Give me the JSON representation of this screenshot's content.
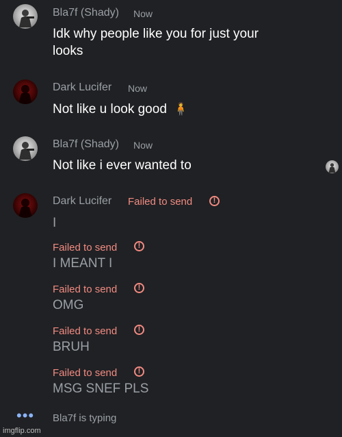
{
  "messages": [
    {
      "sender": "Bla7f (Shady)",
      "time": "Now",
      "text_line1": "Idk why people like you for just your",
      "text_line2": "looks"
    },
    {
      "sender": "Dark Lucifer",
      "time": "Now",
      "text": "Not like u look good",
      "emoji": "🧍"
    },
    {
      "sender": "Bla7f (Shady)",
      "time": "Now",
      "text": "Not like i ever wanted to"
    },
    {
      "sender": "Dark Lucifer",
      "status": "Failed to send",
      "text": "I"
    }
  ],
  "failed_messages": [
    {
      "status": "Failed to send",
      "text": "I MEANT I"
    },
    {
      "status": "Failed to send",
      "text": "OMG"
    },
    {
      "status": "Failed to send",
      "text": "BRUH"
    },
    {
      "status": "Failed to send",
      "text": "MSG SNEF PLS"
    }
  ],
  "error_icon_glyph": "!",
  "typing": {
    "dots": "•••",
    "text": "Bla7f is typing"
  },
  "watermark": "imgflip.com",
  "colors": {
    "background": "#202124",
    "error": "#f28b82",
    "muted": "#9aa0a6",
    "typing_dots": "#8ab4f8"
  }
}
